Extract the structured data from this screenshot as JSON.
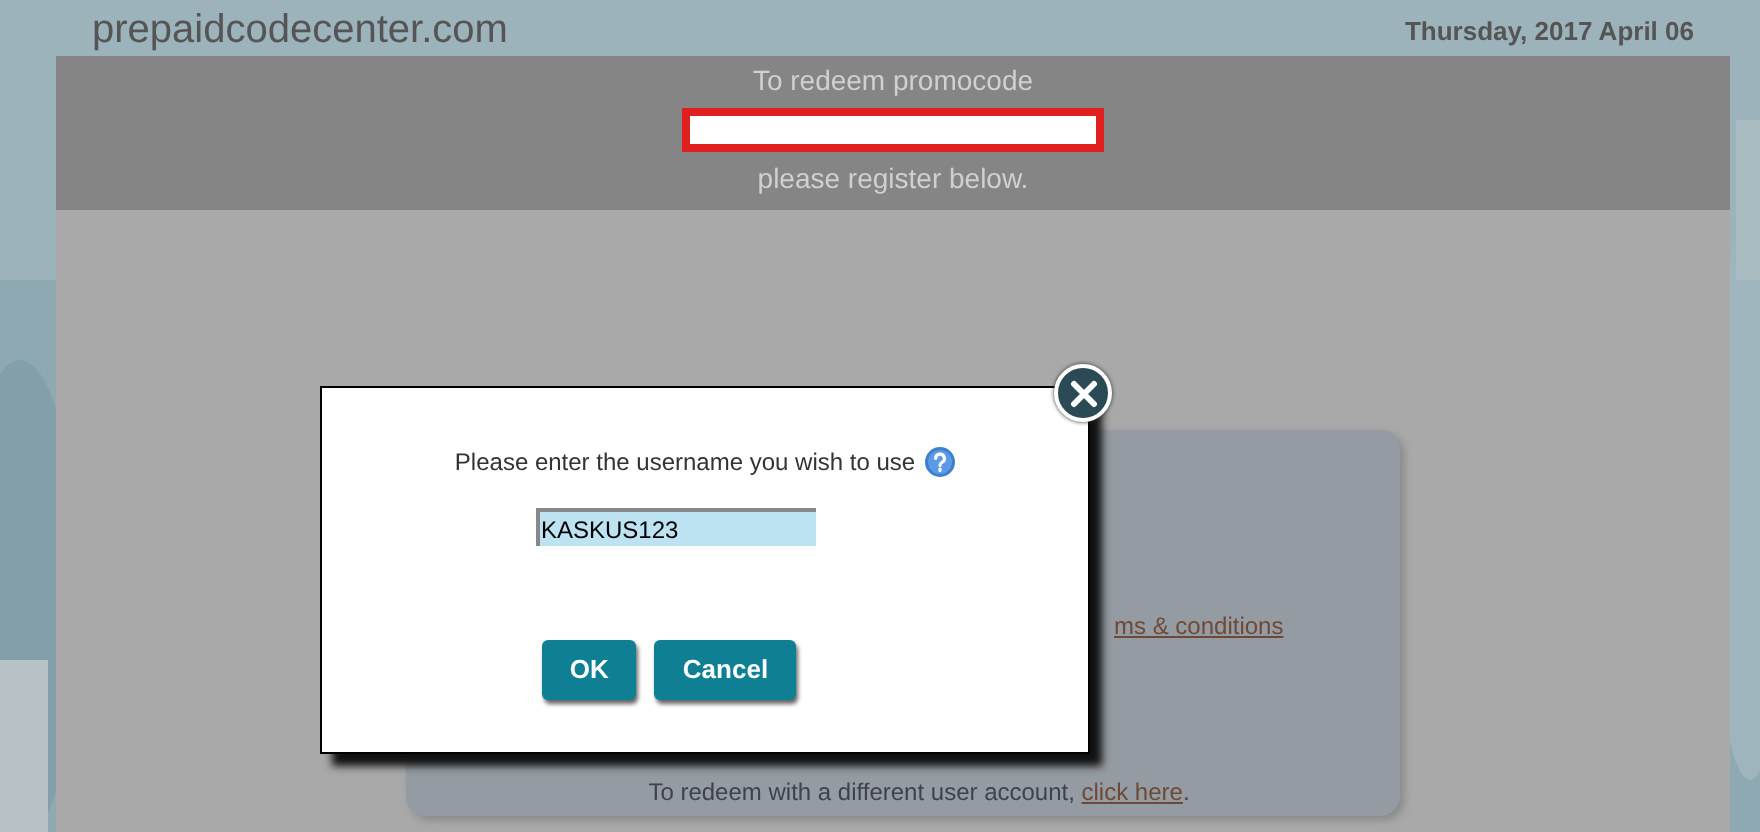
{
  "site_title": "prepaidcodecenter.com",
  "date": "Thursday, 2017 April 06",
  "banner": {
    "heading": "To redeem promocode",
    "subheading": "please register below."
  },
  "card": {
    "terms_link": "ms & conditions",
    "footer_text": "To redeem with a different user account, ",
    "footer_link": "click here",
    "footer_end": "."
  },
  "dialog": {
    "prompt": "Please enter the username you wish to use",
    "username": "KASKUS123",
    "buttons": [
      {
        "label": "OK"
      },
      {
        "label": "Cancel"
      }
    ]
  }
}
